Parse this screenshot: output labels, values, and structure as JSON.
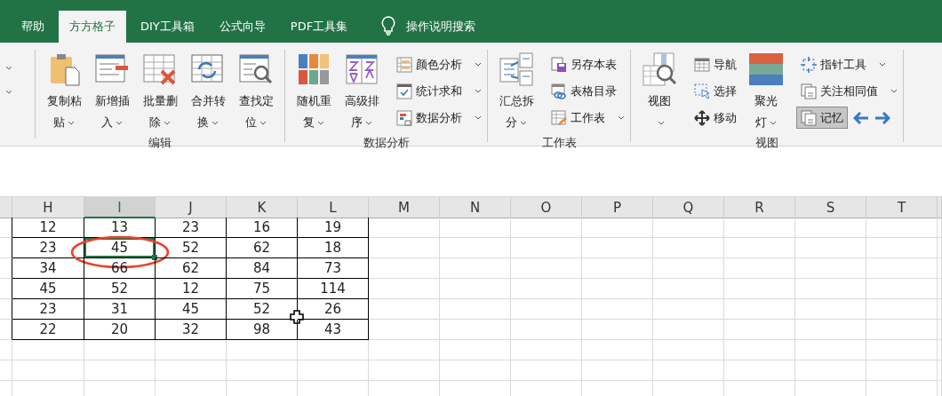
{
  "tabs": [
    {
      "label": "帮助",
      "selected": false
    },
    {
      "label": "方方格子",
      "selected": true
    },
    {
      "label": "DIY工具箱",
      "selected": false
    },
    {
      "label": "公式向导",
      "selected": false
    },
    {
      "label": "PDF工具集",
      "selected": false
    }
  ],
  "search": {
    "label": "操作说明搜索"
  },
  "ribbon_groups": [
    {
      "label": "编辑",
      "columns": [
        {
          "kind": "large",
          "lines": [
            "复制粘",
            "贴"
          ],
          "dropdown": true
        },
        {
          "kind": "large",
          "lines": [
            "新增插",
            "入"
          ],
          "dropdown": true
        },
        {
          "kind": "large",
          "lines": [
            "批量删",
            "除"
          ],
          "dropdown": true
        },
        {
          "kind": "large",
          "lines": [
            "合并转",
            "换"
          ],
          "dropdown": true
        },
        {
          "kind": "large",
          "lines": [
            "查找定",
            "位"
          ],
          "dropdown": true
        }
      ]
    },
    {
      "label": "数据分析",
      "columns": [
        {
          "kind": "large",
          "lines": [
            "随机重",
            "复"
          ],
          "dropdown": true
        },
        {
          "kind": "large",
          "lines": [
            "高级排",
            "序"
          ],
          "dropdown": true
        },
        {
          "kind": "stack",
          "rows": [
            [
              {
                "kind": "small",
                "label": "颜色分析",
                "dropdown": true,
                "pressed": false
              }
            ],
            [
              {
                "kind": "small",
                "label": "统计求和",
                "dropdown": true,
                "pressed": false
              }
            ],
            [
              {
                "kind": "small",
                "label": "数据分析",
                "dropdown": true,
                "pressed": false
              }
            ]
          ]
        }
      ]
    },
    {
      "label": "工作表",
      "columns": [
        {
          "kind": "large",
          "lines": [
            "汇总拆",
            "分"
          ],
          "dropdown": true
        },
        {
          "kind": "stack",
          "rows": [
            [
              {
                "kind": "small",
                "label": "另存本表",
                "dropdown": false,
                "pressed": false
              }
            ],
            [
              {
                "kind": "small",
                "label": "表格目录",
                "dropdown": false,
                "pressed": false
              }
            ],
            [
              {
                "kind": "small",
                "label": "工作表",
                "dropdown": true,
                "pressed": false
              }
            ]
          ]
        }
      ]
    },
    {
      "label": "视图",
      "columns": [
        {
          "kind": "large",
          "lines": [
            "视图"
          ],
          "dropdown": true
        },
        {
          "kind": "stack",
          "rows": [
            [
              {
                "kind": "small",
                "label": "导航",
                "dropdown": false,
                "pressed": false
              }
            ],
            [
              {
                "kind": "small",
                "label": "选择",
                "dropdown": false,
                "pressed": false
              }
            ],
            [
              {
                "kind": "small",
                "label": "移动",
                "dropdown": false,
                "pressed": false
              }
            ]
          ]
        },
        {
          "kind": "large",
          "lines": [
            "聚光",
            "灯"
          ],
          "dropdown": true
        },
        {
          "kind": "stack",
          "rows": [
            [
              {
                "kind": "small",
                "label": "指针工具",
                "dropdown": true,
                "pressed": false
              }
            ],
            [
              {
                "kind": "small",
                "label": "关注相同值",
                "dropdown": true,
                "pressed": false
              }
            ],
            [
              {
                "kind": "small",
                "label": "记忆",
                "dropdown": false,
                "pressed": true
              },
              {
                "kind": "arrow-left"
              },
              {
                "kind": "arrow-right"
              }
            ]
          ]
        }
      ]
    }
  ],
  "sheet": {
    "columns": [
      {
        "letter": "H",
        "selected": false
      },
      {
        "letter": "I",
        "selected": true
      },
      {
        "letter": "J",
        "selected": false
      },
      {
        "letter": "K",
        "selected": false
      },
      {
        "letter": "L",
        "selected": false
      },
      {
        "letter": "M",
        "selected": false
      },
      {
        "letter": "N",
        "selected": false
      },
      {
        "letter": "O",
        "selected": false
      },
      {
        "letter": "P",
        "selected": false
      },
      {
        "letter": "Q",
        "selected": false
      },
      {
        "letter": "R",
        "selected": false
      },
      {
        "letter": "S",
        "selected": false
      },
      {
        "letter": "T",
        "selected": false
      }
    ],
    "rows": [
      {
        "cells": [
          {
            "value": "12",
            "selected": false
          },
          {
            "value": "13",
            "selected": false
          },
          {
            "value": "23",
            "selected": false
          },
          {
            "value": "16",
            "selected": false
          },
          {
            "value": "19",
            "selected": false
          }
        ]
      },
      {
        "cells": [
          {
            "value": "23",
            "selected": false
          },
          {
            "value": "45",
            "selected": true
          },
          {
            "value": "52",
            "selected": false
          },
          {
            "value": "62",
            "selected": false
          },
          {
            "value": "18",
            "selected": false
          }
        ]
      },
      {
        "cells": [
          {
            "value": "34",
            "selected": false
          },
          {
            "value": "66",
            "selected": false
          },
          {
            "value": "62",
            "selected": false
          },
          {
            "value": "84",
            "selected": false
          },
          {
            "value": "73",
            "selected": false
          }
        ]
      },
      {
        "cells": [
          {
            "value": "45",
            "selected": false
          },
          {
            "value": "52",
            "selected": false
          },
          {
            "value": "12",
            "selected": false
          },
          {
            "value": "75",
            "selected": false
          },
          {
            "value": "114",
            "selected": false
          }
        ]
      },
      {
        "cells": [
          {
            "value": "23",
            "selected": false
          },
          {
            "value": "31",
            "selected": false
          },
          {
            "value": "45",
            "selected": false
          },
          {
            "value": "52",
            "selected": false
          },
          {
            "value": "26",
            "selected": false
          }
        ]
      },
      {
        "cells": [
          {
            "value": "22",
            "selected": false
          },
          {
            "value": "20",
            "selected": false
          },
          {
            "value": "32",
            "selected": false
          },
          {
            "value": "98",
            "selected": false
          },
          {
            "value": "43",
            "selected": false
          }
        ]
      }
    ]
  }
}
